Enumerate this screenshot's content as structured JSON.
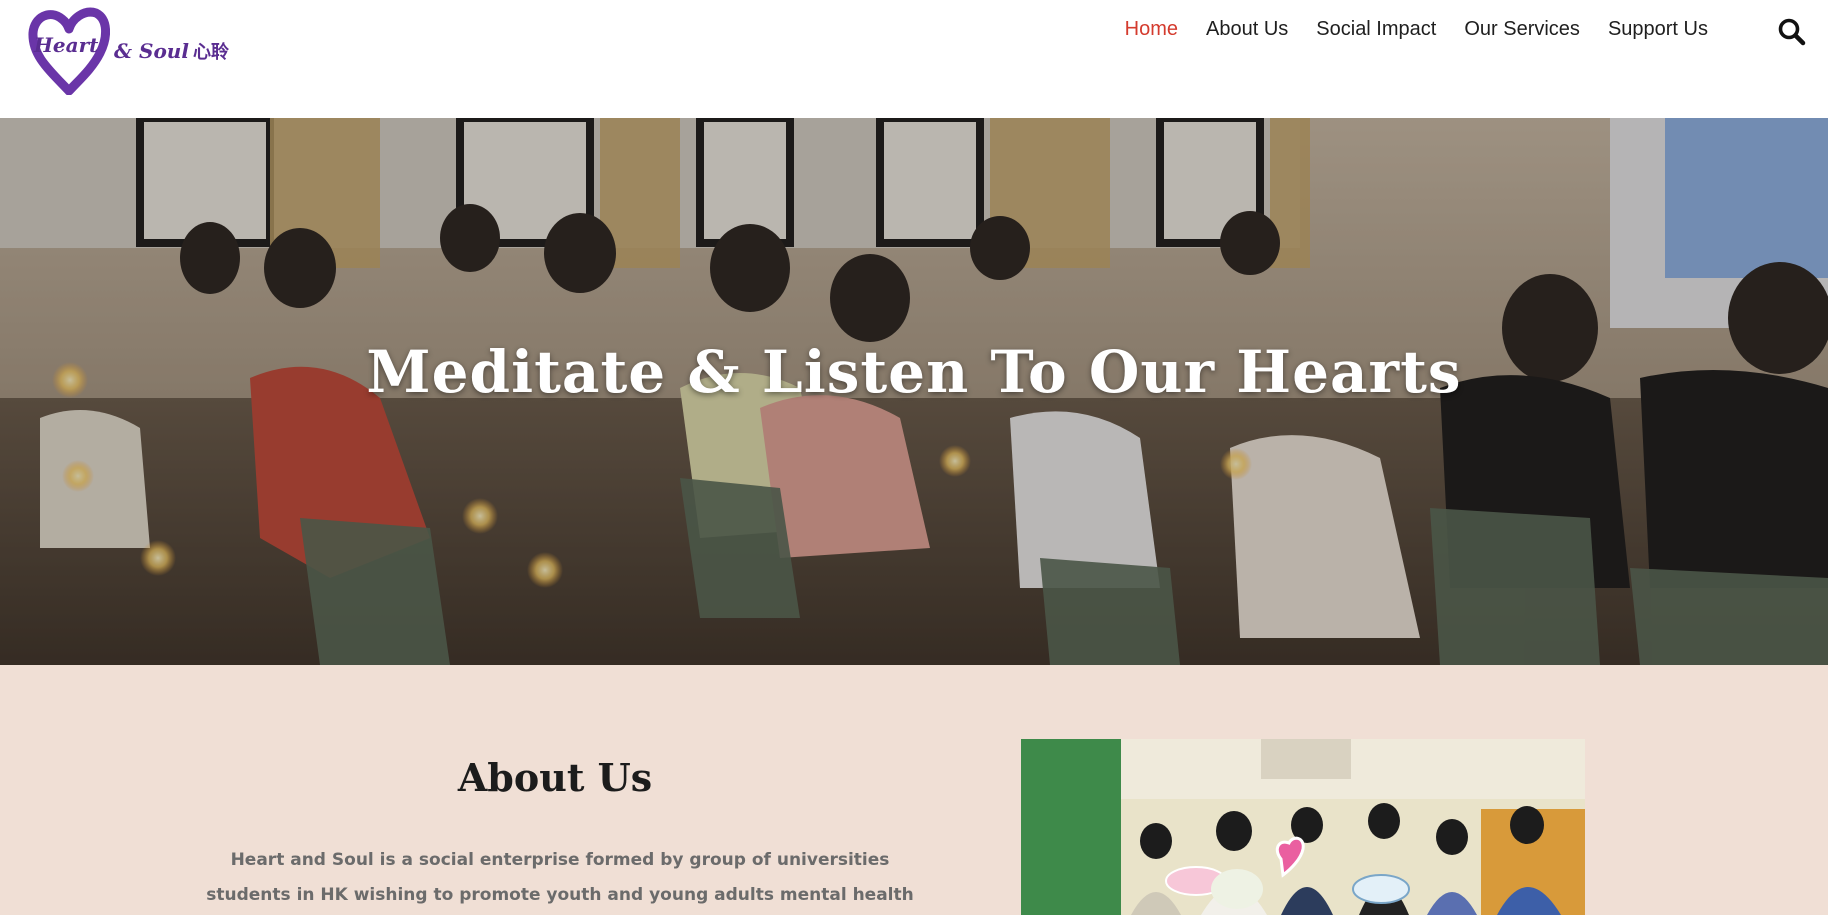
{
  "logo": {
    "heart_text": "Heart",
    "rest_text": "& Soul",
    "cjk_text": "心聆",
    "color": "#5a2d91"
  },
  "nav": {
    "items": [
      {
        "label": "Home",
        "active": true
      },
      {
        "label": "About Us",
        "active": false
      },
      {
        "label": "Social Impact",
        "active": false
      },
      {
        "label": "Our Services",
        "active": false
      },
      {
        "label": "Support Us",
        "active": false
      }
    ],
    "active_color": "#d43b2e",
    "search_icon": "search-icon"
  },
  "hero": {
    "title": "Meditate & Listen To Our Hearts"
  },
  "about": {
    "heading": "About Us",
    "body": "Heart and Soul is a social enterprise formed by group of universities students in HK wishing to promote youth and young adults mental health with meditation and",
    "background": "#f0dfd5"
  }
}
